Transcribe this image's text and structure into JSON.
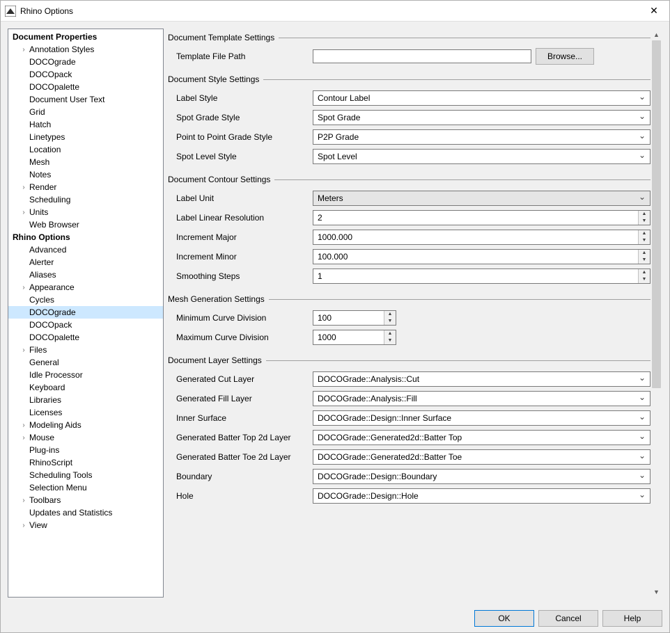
{
  "window": {
    "title": "Rhino Options",
    "close_label": "✕"
  },
  "tree": {
    "sections": [
      {
        "label": "Document Properties",
        "items": [
          {
            "label": "Annotation Styles",
            "expandable": true
          },
          {
            "label": "DOCOgrade"
          },
          {
            "label": "DOCOpack"
          },
          {
            "label": "DOCOpalette"
          },
          {
            "label": "Document User Text"
          },
          {
            "label": "Grid"
          },
          {
            "label": "Hatch"
          },
          {
            "label": "Linetypes"
          },
          {
            "label": "Location"
          },
          {
            "label": "Mesh"
          },
          {
            "label": "Notes"
          },
          {
            "label": "Render",
            "expandable": true
          },
          {
            "label": "Scheduling"
          },
          {
            "label": "Units",
            "expandable": true
          },
          {
            "label": "Web Browser"
          }
        ]
      },
      {
        "label": "Rhino Options",
        "items": [
          {
            "label": "Advanced"
          },
          {
            "label": "Alerter"
          },
          {
            "label": "Aliases"
          },
          {
            "label": "Appearance",
            "expandable": true
          },
          {
            "label": "Cycles"
          },
          {
            "label": "DOCOgrade",
            "selected": true
          },
          {
            "label": "DOCOpack"
          },
          {
            "label": "DOCOpalette"
          },
          {
            "label": "Files",
            "expandable": true
          },
          {
            "label": "General"
          },
          {
            "label": "Idle Processor"
          },
          {
            "label": "Keyboard"
          },
          {
            "label": "Libraries"
          },
          {
            "label": "Licenses"
          },
          {
            "label": "Modeling Aids",
            "expandable": true
          },
          {
            "label": "Mouse",
            "expandable": true
          },
          {
            "label": "Plug-ins"
          },
          {
            "label": "RhinoScript"
          },
          {
            "label": "Scheduling Tools"
          },
          {
            "label": "Selection Menu"
          },
          {
            "label": "Toolbars",
            "expandable": true
          },
          {
            "label": "Updates and Statistics"
          },
          {
            "label": "View",
            "expandable": true
          }
        ]
      }
    ]
  },
  "settings": {
    "template": {
      "header": "Document Template Settings",
      "file_path_label": "Template File Path",
      "file_path_value": "",
      "browse_label": "Browse..."
    },
    "style": {
      "header": "Document Style Settings",
      "label_style_label": "Label Style",
      "label_style_value": "Contour Label",
      "spot_grade_label": "Spot Grade Style",
      "spot_grade_value": "Spot Grade",
      "p2p_label": "Point to Point Grade Style",
      "p2p_value": "P2P Grade",
      "spot_level_label": "Spot Level Style",
      "spot_level_value": "Spot Level"
    },
    "contour": {
      "header": "Document Contour Settings",
      "label_unit_label": "Label Unit",
      "label_unit_value": "Meters",
      "resolution_label": "Label Linear Resolution",
      "resolution_value": "2",
      "inc_major_label": "Increment Major",
      "inc_major_value": "1000.000",
      "inc_minor_label": "Increment Minor",
      "inc_minor_value": "100.000",
      "smoothing_label": "Smoothing Steps",
      "smoothing_value": "1"
    },
    "mesh": {
      "header": "Mesh Generation Settings",
      "min_div_label": "Minimum Curve Division",
      "min_div_value": "100",
      "max_div_label": "Maximum Curve Division",
      "max_div_value": "1000"
    },
    "layer": {
      "header": "Document Layer Settings",
      "cut_label": "Generated Cut Layer",
      "cut_value": "DOCOGrade::Analysis::Cut",
      "fill_label": "Generated Fill Layer",
      "fill_value": "DOCOGrade::Analysis::Fill",
      "inner_label": "Inner Surface",
      "inner_value": "DOCOGrade::Design::Inner Surface",
      "batter_top_label": "Generated Batter Top 2d Layer",
      "batter_top_value": "DOCOGrade::Generated2d::Batter Top",
      "batter_toe_label": "Generated Batter Toe 2d Layer",
      "batter_toe_value": "DOCOGrade::Generated2d::Batter Toe",
      "boundary_label": "Boundary",
      "boundary_value": "DOCOGrade::Design::Boundary",
      "hole_label": "Hole",
      "hole_value": "DOCOGrade::Design::Hole"
    }
  },
  "footer": {
    "ok": "OK",
    "cancel": "Cancel",
    "help": "Help"
  }
}
